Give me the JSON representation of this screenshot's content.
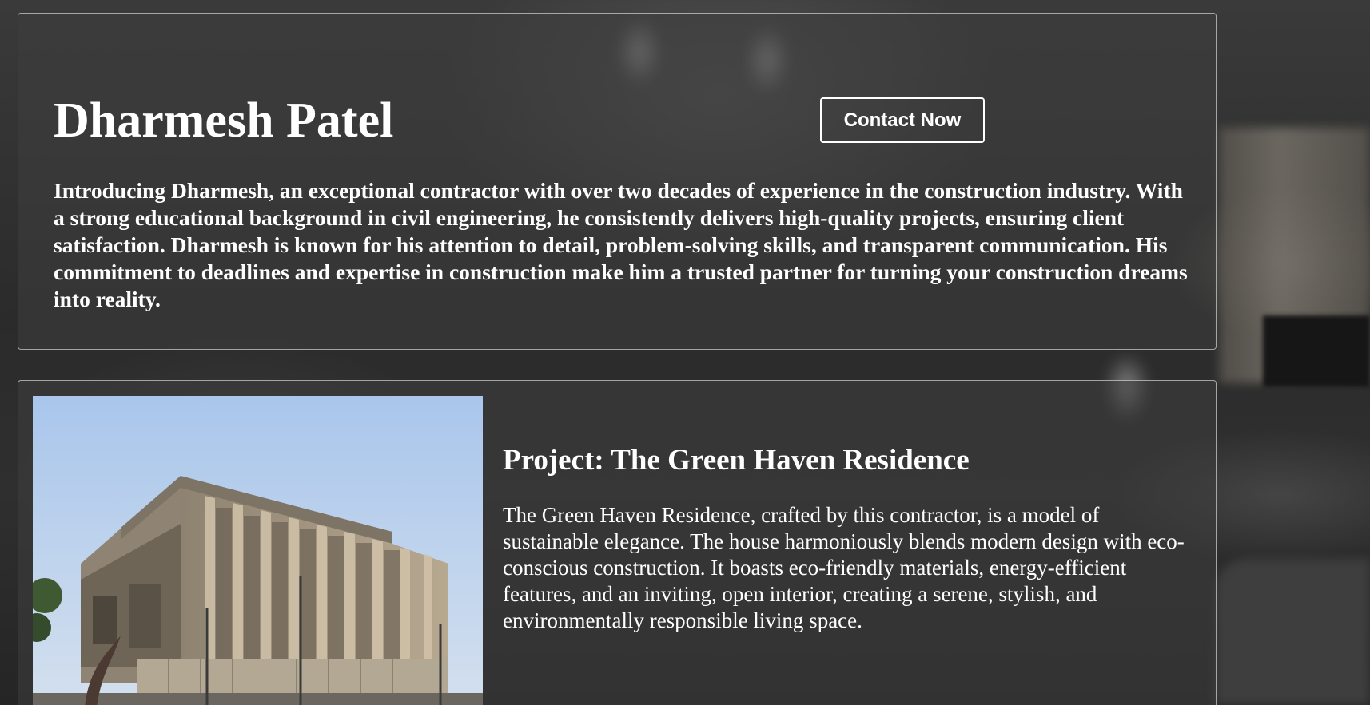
{
  "profile": {
    "name": "Dharmesh Patel",
    "contact_label": "Contact Now",
    "bio": "Introducing Dharmesh, an exceptional contractor with over two decades of experience in the construction industry. With a strong educational background in civil engineering, he consistently delivers high-quality projects, ensuring client satisfaction. Dharmesh is known for his attention to detail, problem-solving skills, and transparent communication. His commitment to deadlines and expertise in construction make him a trusted partner for turning your construction dreams into reality."
  },
  "project": {
    "title": "Project: The Green Haven Residence",
    "description": "The Green Haven Residence, crafted by this contractor, is a model of sustainable elegance. The house harmoniously blends modern design with eco-conscious construction. It boasts eco-friendly materials, energy-efficient features, and an inviting, open interior, creating a serene, stylish, and environmentally responsible living space.",
    "image_subject": "brutalist-concrete-building-photo"
  },
  "colors": {
    "text": "#ffffff",
    "card_border": "#bfbfbf",
    "background": "#2f2f2f",
    "sky": "#b9cfe8",
    "concrete": "#a89a86"
  }
}
